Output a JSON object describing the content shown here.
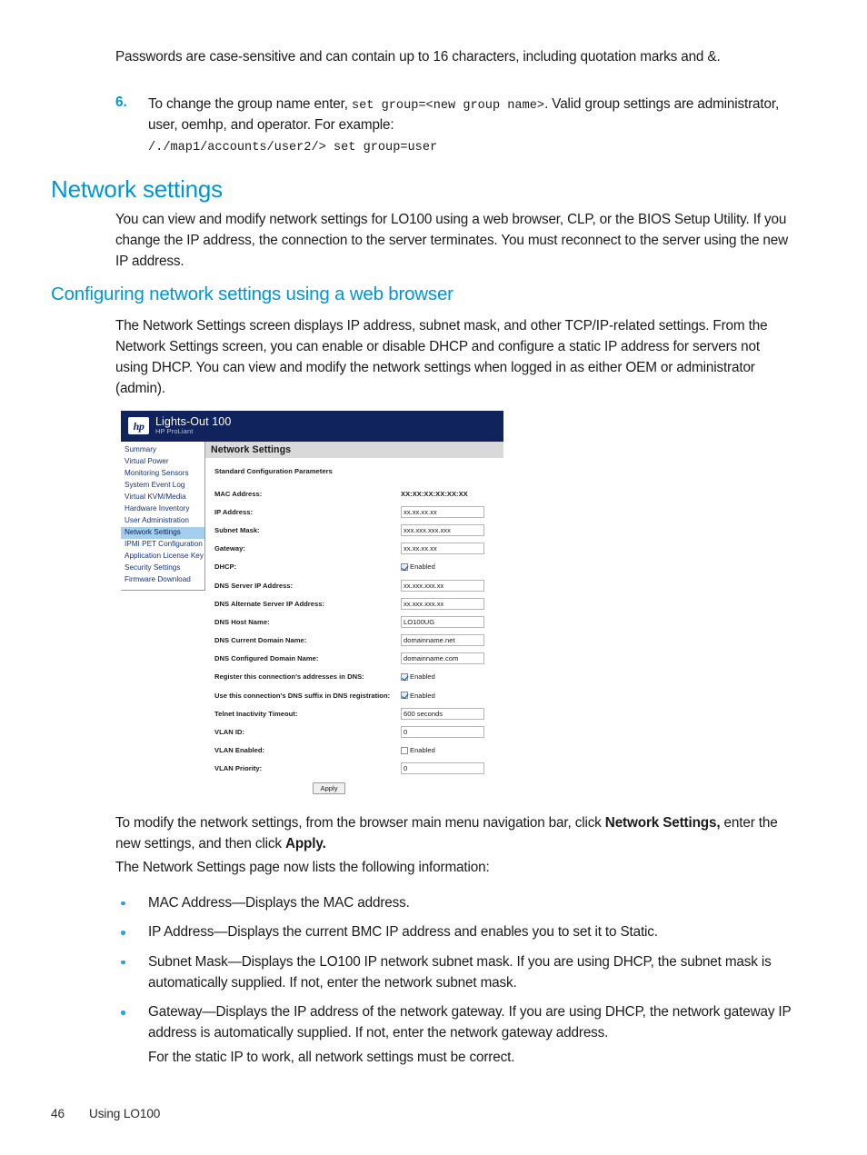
{
  "colors": {
    "heading_blue": "#0096d6",
    "bullet_blue": "#27a3dd",
    "shot_header_navy": "#10235c",
    "nav_link_blue": "#17337a",
    "nav_active_bg": "#a5cdee",
    "panel_title_bg": "#d9d9d9"
  },
  "intro": {
    "passwords_note": "Passwords are case-sensitive and can contain up to 16 characters, including quotation marks and &.",
    "step_number": "6.",
    "step_text_1": "To change the group name enter, ",
    "step_code": "set group=<new group name>",
    "step_text_2": ". Valid group settings are administrator, user, oemhp, and operator. For example:",
    "step_example": "/./map1/accounts/user2/> set group=user"
  },
  "headings": {
    "h1": "Network settings",
    "h2": "Configuring network settings using a web browser"
  },
  "body": {
    "intro_para": "You can view and modify network settings for LO100 using a web browser, CLP, or the BIOS Setup Utility. If you change the IP address, the connection to the server terminates. You must reconnect to the server using the new IP address.",
    "section_para": "The Network Settings screen displays IP address, subnet mask, and other TCP/IP-related settings. From the Network Settings screen, you can enable or disable DHCP and configure a static IP address for servers not using DHCP. You can view and modify the network settings when logged in as either OEM or administrator (admin).",
    "modify_pre": "To modify the network settings, from the browser main menu navigation bar, click ",
    "modify_bold1": "Network Settings,",
    "modify_mid": " enter the new settings, and then click ",
    "modify_bold2": "Apply.",
    "lists_intro": "The Network Settings page now lists the following information:",
    "bullets": [
      "MAC Address—Displays the MAC address.",
      "IP Address—Displays the current BMC IP address and enables you to set it to Static.",
      "Subnet Mask—Displays the LO100 IP network subnet mask. If you are using DHCP, the subnet mask is automatically supplied. If not, enter the network subnet mask.",
      "Gateway—Displays the IP address of the network gateway. If you are using DHCP, the network gateway IP address is automatically supplied. If not, enter the network gateway address."
    ],
    "static_note": "For the static IP to work, all network settings must be correct."
  },
  "screenshot": {
    "logo": {
      "mark": "hp",
      "title": "Lights-Out 100",
      "subtitle": "HP ProLiant"
    },
    "nav": [
      {
        "label": "Summary",
        "active": false
      },
      {
        "label": "Virtual Power",
        "active": false
      },
      {
        "label": "Monitoring Sensors",
        "active": false
      },
      {
        "label": "System Event Log",
        "active": false
      },
      {
        "label": "Virtual KVM/Media",
        "active": false
      },
      {
        "label": "Hardware Inventory",
        "active": false
      },
      {
        "label": "User Administration",
        "active": false
      },
      {
        "label": "Network Settings",
        "active": true
      },
      {
        "label": "IPMI PET Configuration",
        "active": false
      },
      {
        "label": "Application License Key",
        "active": false
      },
      {
        "label": "Security Settings",
        "active": false
      },
      {
        "label": "Firmware Download",
        "active": false
      }
    ],
    "panel_title": "Network Settings",
    "panel_subtitle": "Standard Configuration Parameters",
    "fields": [
      {
        "label": "MAC Address:",
        "type": "static",
        "value": "XX:XX:XX:XX:XX:XX"
      },
      {
        "label": "IP Address:",
        "type": "input",
        "value": "xx.xx.xx.xx"
      },
      {
        "label": "Subnet Mask:",
        "type": "input",
        "value": "xxx.xxx.xxx.xxx"
      },
      {
        "label": "Gateway:",
        "type": "input",
        "value": "xx.xx.xx.xx"
      },
      {
        "label": "DHCP:",
        "type": "checkbox",
        "value": "Enabled",
        "checked": true
      },
      {
        "label": "DNS Server IP Address:",
        "type": "input",
        "value": "xx.xxx.xxx.xx"
      },
      {
        "label": "DNS Alternate Server IP Address:",
        "type": "input",
        "value": "xx.xxx.xxx.xx"
      },
      {
        "label": "DNS Host Name:",
        "type": "input",
        "value": "LO100UG"
      },
      {
        "label": "DNS Current Domain Name:",
        "type": "input",
        "value": "domainname.net"
      },
      {
        "label": "DNS Configured Domain Name:",
        "type": "input",
        "value": "domainname.com"
      },
      {
        "label": "Register this connection's addresses in DNS:",
        "type": "checkbox",
        "value": "Enabled",
        "checked": true
      },
      {
        "label": "Use this connection's DNS suffix in DNS registration:",
        "type": "checkbox",
        "value": "Enabled",
        "checked": true
      },
      {
        "label": "Telnet Inactivity Timeout:",
        "type": "input",
        "value": "600 seconds"
      },
      {
        "label": "VLAN ID:",
        "type": "input",
        "value": "0"
      },
      {
        "label": "VLAN Enabled:",
        "type": "checkbox",
        "value": "Enabled",
        "checked": false
      },
      {
        "label": "VLAN Priority:",
        "type": "input",
        "value": "0"
      }
    ],
    "apply_button": "Apply"
  },
  "footer": {
    "page_number": "46",
    "chapter": "Using LO100"
  }
}
